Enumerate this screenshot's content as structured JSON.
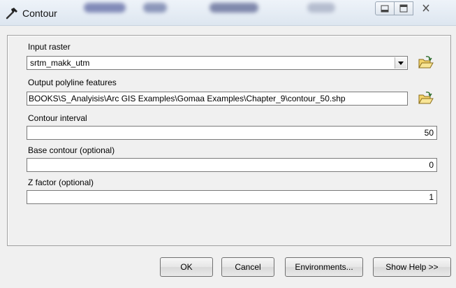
{
  "window": {
    "title": "Contour"
  },
  "fields": {
    "input_raster": {
      "label": "Input raster",
      "value": "srtm_makk_utm"
    },
    "output_polyline": {
      "label": "Output polyline features",
      "value": "BOOKS\\S_Analyisis\\Arc GIS Examples\\Gomaa Examples\\Chapter_9\\contour_50.shp"
    },
    "contour_interval": {
      "label": "Contour interval",
      "value": "50"
    },
    "base_contour": {
      "label": "Base contour (optional)",
      "value": "0"
    },
    "z_factor": {
      "label": "Z factor (optional)",
      "value": "1"
    }
  },
  "buttons": {
    "ok": "OK",
    "cancel": "Cancel",
    "environments": "Environments...",
    "show_help": "Show Help >>"
  },
  "icons": {
    "tool": "hammer-icon",
    "browse": "open-folder-icon",
    "combo": "chevron-down-icon",
    "minimize": "minimize-icon",
    "maximize": "maximize-icon",
    "close": "close-icon"
  }
}
